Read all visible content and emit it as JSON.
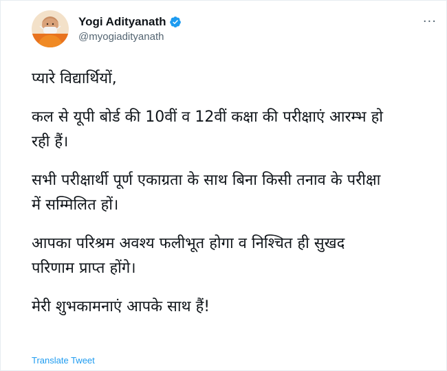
{
  "author": {
    "display_name": "Yogi Adityanath",
    "handle": "@myogiadityanath",
    "verified": true,
    "avatar_icon": "profile-photo-icon"
  },
  "more_menu": {
    "label": "···",
    "icon": "more-options-icon"
  },
  "tweet": {
    "paragraphs": [
      "प्यारे विद्यार्थियों,",
      "कल से यूपी बोर्ड की 10वीं व 12वीं कक्षा की परीक्षाएं आरम्भ हो\nरही हैं।",
      "सभी परीक्षार्थी पूर्ण एकाग्रता के साथ बिना किसी तनाव के परीक्षा\nमें सम्मिलित हों।",
      "आपका परिश्रम अवश्य फलीभूत होगा व निश्चित ही सुखद\nपरिणाम प्राप्त होंगे।",
      "मेरी शुभकामनाएं आपके साथ हैं!"
    ]
  },
  "translate_link": "Translate Tweet",
  "colors": {
    "link": "#1d9bf0",
    "verified_badge": "#1d9bf0",
    "secondary_text": "#536471"
  }
}
